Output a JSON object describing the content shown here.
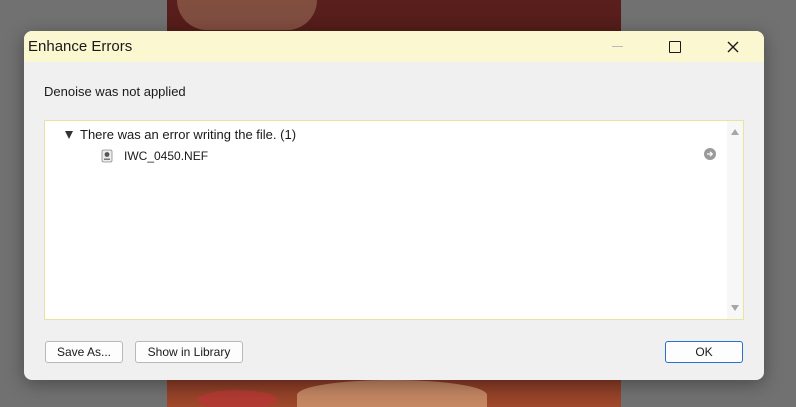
{
  "window": {
    "title": "Enhance Errors"
  },
  "message": "Denoise was not applied",
  "error_list": {
    "groups": [
      {
        "label": "There was an error writing the file. (1)",
        "expanded": true,
        "items": [
          {
            "filename": "IWC_0450.NEF",
            "icon": "raw-file-icon",
            "action_icon": "go-to-arrow-icon"
          }
        ]
      }
    ]
  },
  "buttons": {
    "save_as": "Save As...",
    "show_in_library": "Show in Library",
    "ok": "OK"
  },
  "colors": {
    "titlebar": "#fbf7d0",
    "dialog_bg": "#f0f0f0",
    "list_border": "#e8e2a3",
    "ok_border": "#2a6fcf"
  }
}
